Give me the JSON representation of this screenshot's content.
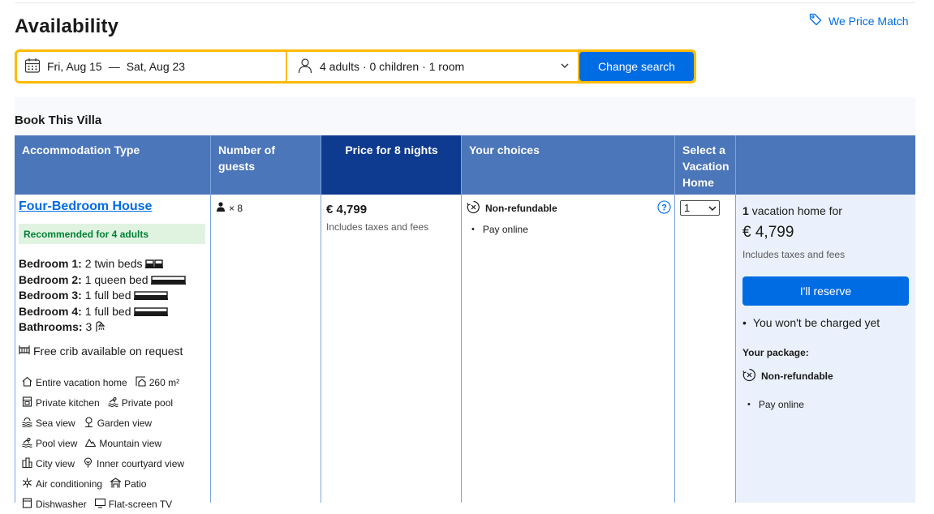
{
  "header": {
    "title": "Availability",
    "price_match": "We Price Match"
  },
  "search": {
    "check_in": "Fri, Aug 15",
    "separator": "—",
    "check_out": "Sat, Aug 23",
    "occupancy": "4 adults · 0 children · 1 room",
    "button": "Change search"
  },
  "section_title": "Book This Villa",
  "table": {
    "columns": [
      "Accommodation Type",
      "Number of guests",
      "Price for 8 nights",
      "Your choices",
      "Select a Vacation Home",
      ""
    ],
    "row": {
      "name": "Four-Bedroom House",
      "recommendation": "Recommended for 4 adults",
      "beds": [
        {
          "label": "Bedroom 1:",
          "value": "2 twin beds"
        },
        {
          "label": "Bedroom 2:",
          "value": "1 queen bed"
        },
        {
          "label": "Bedroom 3:",
          "value": "1 full bed"
        },
        {
          "label": "Bedroom 4:",
          "value": "1 full bed"
        },
        {
          "label": "Bathrooms:",
          "value": "3"
        }
      ],
      "crib": "Free crib available on request",
      "facilities": [
        [
          "Entire vacation home",
          "260 m²"
        ],
        [
          "Private kitchen",
          "Private pool"
        ],
        [
          "Sea view",
          "Garden view"
        ],
        [
          "Pool view",
          "Mountain view"
        ],
        [
          "City view",
          "Inner courtyard view"
        ],
        [
          "Air conditioning",
          "Patio"
        ],
        [
          "Dishwasher",
          "Flat-screen TV"
        ]
      ],
      "guests": "× 8",
      "price": "€ 4,799",
      "taxes": "Includes taxes and fees",
      "choice_title": "Non-refundable",
      "choice_item": "Pay online",
      "select_value": "1"
    }
  },
  "summary": {
    "count": "1",
    "line": "vacation home for",
    "price": "€ 4,799",
    "taxes": "Includes taxes and fees",
    "reserve": "I'll reserve",
    "not_charged": "You won't be charged yet",
    "package_label": "Your package:",
    "package_policy": "Non-refundable",
    "package_item": "Pay online"
  },
  "colors": {
    "accent": "#006ce4",
    "header": "#4b76b9",
    "header_active": "#0e3a8f",
    "search_border": "#febb02",
    "recommend_bg": "#e0f3e1",
    "recommend_text": "#008234"
  }
}
